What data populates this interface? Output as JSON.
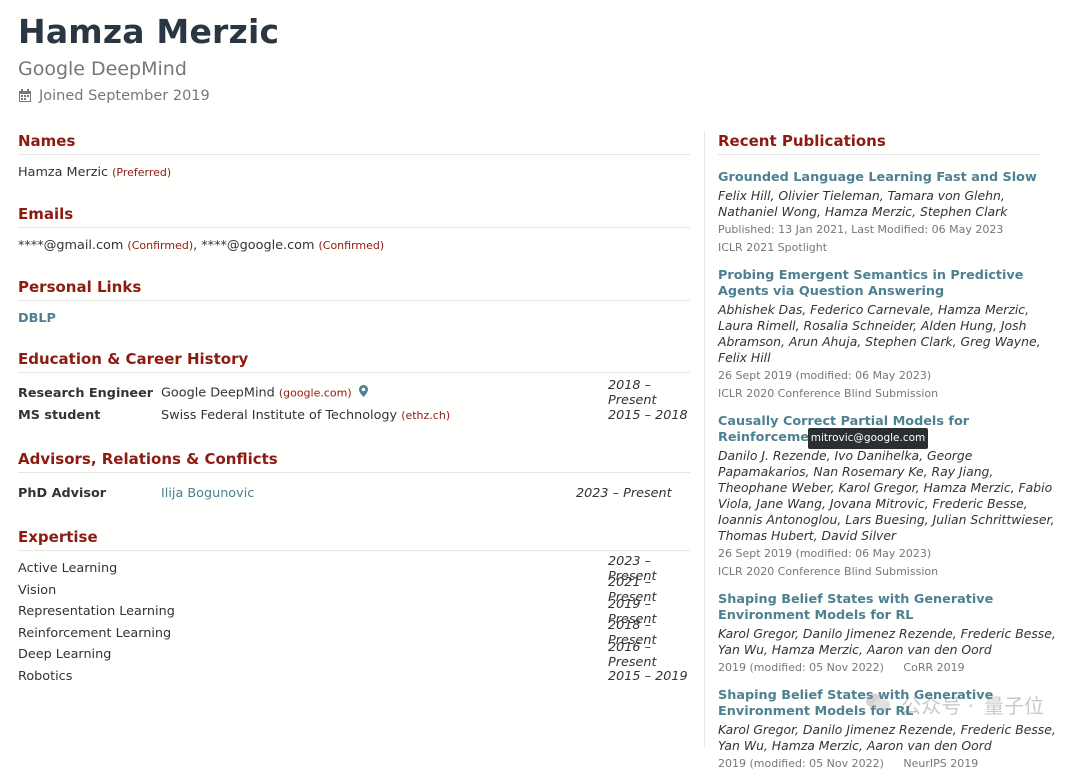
{
  "profile": {
    "name": "Hamza Merzic",
    "institution": "Google DeepMind",
    "joined": "Joined September 2019"
  },
  "sections": {
    "names": {
      "title": "Names",
      "value": "Hamza Merzic",
      "note": "(Preferred)"
    },
    "emails": {
      "title": "Emails",
      "items": [
        {
          "address": "****@gmail.com",
          "note": "(Confirmed)"
        },
        {
          "address": "****@google.com",
          "note": "(Confirmed)"
        }
      ],
      "separator": ","
    },
    "links": {
      "title": "Personal Links",
      "items": [
        "DBLP"
      ]
    },
    "history": {
      "title": "Education & Career History",
      "rows": [
        {
          "position": "Research Engineer",
          "institution": "Google DeepMind",
          "domain": "(google.com)",
          "years": "2018 – Present"
        },
        {
          "position": "MS student",
          "institution": "Swiss Federal Institute of Technology",
          "domain": "(ethz.ch)",
          "years": "2015 – 2018"
        }
      ]
    },
    "advisors": {
      "title": "Advisors, Relations & Conflicts",
      "rows": [
        {
          "relation": "PhD Advisor",
          "person": "Ilija Bogunovic",
          "years": "2023 – Present"
        }
      ]
    },
    "expertise": {
      "title": "Expertise",
      "rows": [
        {
          "topic": "Active Learning",
          "years": "2023 – Present"
        },
        {
          "topic": "Vision",
          "years": "2021 – Present"
        },
        {
          "topic": "Representation Learning",
          "years": "2019 – Present"
        },
        {
          "topic": "Reinforcement Learning",
          "years": "2018 – Present"
        },
        {
          "topic": "Deep Learning",
          "years": "2016 – Present"
        },
        {
          "topic": "Robotics",
          "years": "2015 – 2019"
        }
      ]
    }
  },
  "publications": {
    "title": "Recent Publications",
    "items": [
      {
        "title": "Grounded Language Learning Fast and Slow",
        "authors": "Felix Hill, Olivier Tieleman, Tamara von Glehn, Nathaniel Wong, Hamza Merzic, Stephen Clark",
        "meta": "Published: 13 Jan 2021, Last Modified: 06 May 2023",
        "venue": "ICLR 2021 Spotlight"
      },
      {
        "title": "Probing Emergent Semantics in Predictive Agents via Question Answering",
        "authors": "Abhishek Das, Federico Carnevale, Hamza Merzic, Laura Rimell, Rosalia Schneider, Alden Hung, Josh Abramson, Arun Ahuja, Stephen Clark, Greg Wayne, Felix Hill",
        "meta": "26 Sept 2019 (modified: 06 May 2023)",
        "venue": "ICLR 2020 Conference Blind Submission"
      },
      {
        "title": "Causally Correct Partial Models for Reinforcement Learning",
        "authors": "Danilo J. Rezende, Ivo Danihelka, George Papamakarios, Nan Rosemary Ke, Ray Jiang, Theophane Weber, Karol Gregor, Hamza Merzic, Fabio Viola, Jane Wang, Jovana Mitrovic, Frederic Besse, Ioannis Antonoglou, Lars Buesing, Julian Schrittwieser, Thomas Hubert, David Silver",
        "meta": "26 Sept 2019 (modified: 06 May 2023)",
        "venue": "ICLR 2020 Conference Blind Submission"
      },
      {
        "title": "Shaping Belief States with Generative Environment Models for RL",
        "authors": "Karol Gregor, Danilo Jimenez Rezende, Frederic Besse, Yan Wu, Hamza Merzic, Aaron van den Oord",
        "meta": "2019 (modified: 05 Nov 2022)",
        "venue": "CoRR 2019"
      },
      {
        "title": "Shaping Belief States with Generative Environment Models for RL",
        "authors": "Karol Gregor, Danilo Jimenez Rezende, Frederic Besse, Yan Wu, Hamza Merzic, Aaron van den Oord",
        "meta": "2019 (modified: 05 Nov 2022)",
        "venue": "NeurIPS 2019"
      }
    ]
  },
  "tooltip": "mitrovic@google.com",
  "watermark": {
    "left": "公众号 ·",
    "right": "量子位"
  },
  "icons": {
    "calendar": "calendar-icon",
    "location": "map-marker-icon"
  },
  "colors": {
    "accent": "#8c1b13",
    "link": "#4d8093",
    "heading": "#2b3644"
  }
}
